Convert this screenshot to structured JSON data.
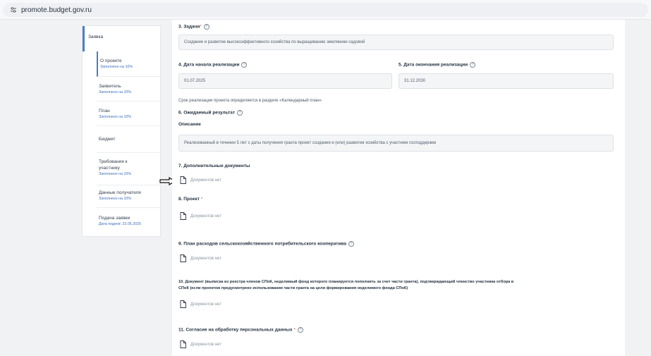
{
  "browser": {
    "url": "promote.budget.gov.ru"
  },
  "sidebar": {
    "group_label": "Заявка",
    "items": [
      {
        "label": "О проекте",
        "sub": "Заполнено на 10%"
      },
      {
        "label": "Заявитель",
        "sub": "Заполнено на 10%"
      },
      {
        "label": "План",
        "sub": "Заполнено на 10%"
      },
      {
        "label": "Бюджет",
        "sub": ""
      },
      {
        "label_line1": "Требования к",
        "label_line2": "участнику",
        "sub": "Заполнено на 10%"
      },
      {
        "label": "Данные получателя",
        "sub": "Заполнено на 10%"
      },
      {
        "label": "Подача заявки",
        "sub": "Дата подачи: 23.05.2025"
      }
    ]
  },
  "form": {
    "tasks": {
      "title": "3. Задачи",
      "required_mark": "*",
      "value": "Создание и развитие высокоэффективного хозяйства по выращиванию земляники садовой"
    },
    "start_date": {
      "title": "4. Дата начала реализации",
      "value": "01.07.2025"
    },
    "end_date": {
      "title": "5. Дата окончания реализации",
      "value": "31.12.2030"
    },
    "period_note": "Срок реализации проекта определяется в разделе «Календарный план»",
    "result": {
      "title": "6. Ожидаемый результат",
      "subtitle": "Описание",
      "value": "Реализованный в течении 5 лет с даты получения гранта проект создания и (или) развития хозяйства с участием господдержки"
    },
    "extra_docs": {
      "title": "7. Дополнительные документы",
      "empty": "Документов нет"
    },
    "project": {
      "title": "8. Проект",
      "required_mark": "*",
      "empty": "Документов нет"
    },
    "expense_plan": {
      "title": "9. План расходов сельскохозяйственного потребительского кооператива",
      "empty": "Документов нет"
    },
    "document": {
      "title_line1": "10. Документ (выписка из реестра членов СПоК, неделимый фонд которого планируется пополнить за счет части гранта), подтверждающий членство участника отбора в",
      "title_line2": "СПоК (если проектом предусмотрено использование части гранта на цели формирования неделимого фонда СПоК)",
      "empty": "Документов нет"
    },
    "consent": {
      "title": "11. Согласие на обработку персональных данных",
      "required_mark": "*",
      "empty": "Документов нет"
    }
  },
  "colors": {
    "accent": "#4a7dc8",
    "required": "#d9534f",
    "link": "#3e6fb8"
  },
  "icons": {
    "help": "question-circle-icon",
    "document": "document-icon",
    "site_settings": "tune-icon",
    "pointer": "arrow-right-icon"
  }
}
